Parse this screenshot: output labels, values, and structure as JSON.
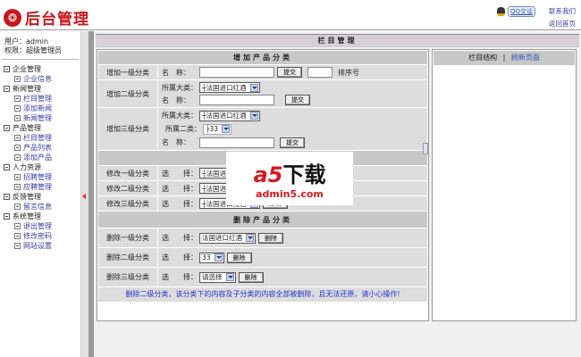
{
  "header": {
    "logo_text": "后台管理",
    "qq_label": "QQ交谈",
    "contact": "联系我们",
    "home": "返回首页"
  },
  "sidebar": {
    "user": "用户：admin",
    "role": "权限：超级管理员",
    "groups": [
      {
        "label": "企业管理",
        "items": [
          "企业信息"
        ]
      },
      {
        "label": "新闻管理",
        "items": [
          "栏目管理",
          "添加新闻",
          "新闻管理"
        ]
      },
      {
        "label": "产品管理",
        "items": [
          "栏目管理",
          "产品列表",
          "添加产品"
        ]
      },
      {
        "label": "人力资源",
        "items": [
          "招聘管理",
          "应聘管理"
        ]
      },
      {
        "label": "反馈管理",
        "items": [
          "留言信息"
        ]
      },
      {
        "label": "系统管理",
        "items": [
          "退出管理",
          "修改密码",
          "网站设置"
        ]
      }
    ]
  },
  "main": {
    "title": "栏目管理",
    "add": {
      "header": "增加产品分类",
      "row1": {
        "label": "增加一级分类",
        "name_label": "名　称：",
        "submit": "提交",
        "sort_label": "排序号"
      },
      "row2": {
        "label": "增加二级分类",
        "parent_label": "所属大类：",
        "parent_value": "┼法国进口红酒",
        "name_label": "名　称：",
        "submit": "提交"
      },
      "row3": {
        "label": "增加三级分类",
        "parent_label": "所属大类：",
        "parent_value": "┼法国进口红酒",
        "sub_label": "所属二类：",
        "sub_value": "├33",
        "name_label": "名　称：",
        "submit": "提交"
      }
    },
    "edit": {
      "rows": [
        {
          "label": "修改一级分类",
          "select_label": "选　　择：",
          "value": "┼法国进口红酒",
          "button": "修改"
        },
        {
          "label": "修改二级分类",
          "select_label": "选　　择：",
          "value": "┼法国进口红酒",
          "button": "修改"
        },
        {
          "label": "修改三级分类",
          "select_label": "选　　择：",
          "value": "┼法国进口红酒",
          "button": "修改"
        }
      ]
    },
    "delete": {
      "header": "删除产品分类",
      "rows": [
        {
          "label": "删除一级分类",
          "select_label": "选　　择：",
          "value": "法国进口红酒",
          "button": "删除"
        },
        {
          "label": "删除二级分类",
          "select_label": "选　　择：",
          "value": "33",
          "button": "删除"
        },
        {
          "label": "删除三级分类",
          "select_label": "选　　择：",
          "value": "请选择",
          "button": "删除"
        }
      ],
      "warning": "删除二级分类，该分类下的内容及子分类的内容全部被删除，且无法还原，请小心操作!"
    },
    "right": {
      "structure": "栏目结构",
      "separator": "|",
      "refresh": "刷新页面"
    }
  },
  "watermark": {
    "big": "a5",
    "big2": "下载",
    "small": "admin5.com"
  }
}
